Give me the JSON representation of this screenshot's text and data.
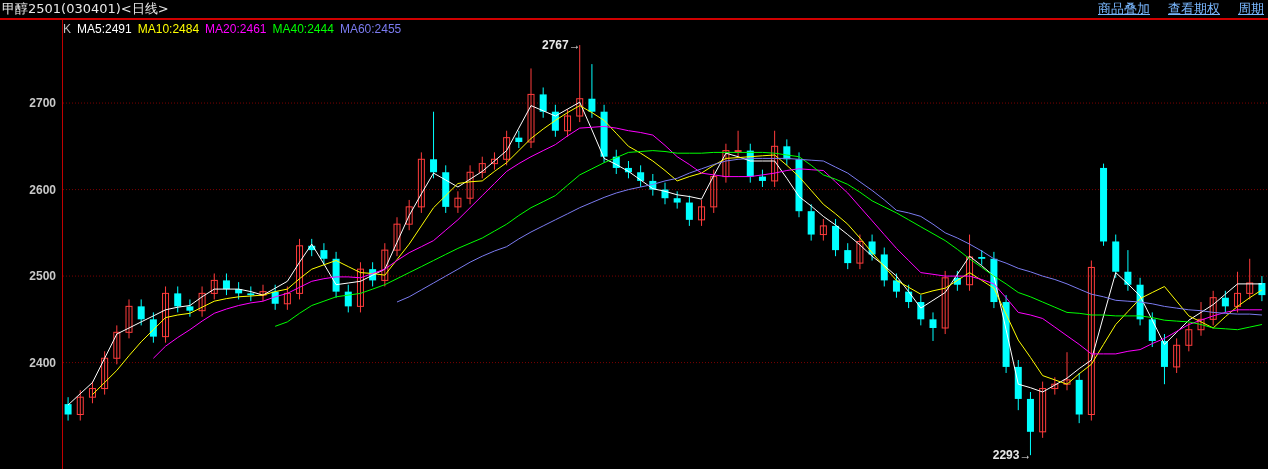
{
  "header": {
    "title": "甲醇2501(030401)<日线>",
    "links": [
      "商品叠加",
      "查看期权",
      "周期"
    ]
  },
  "chart": {
    "candles_label": {
      "text": "K",
      "color": "#c0c0c0"
    },
    "chart_data": {
      "type": "candlestick",
      "ylim": [
        2277,
        2796
      ],
      "yticks": [
        2400,
        2500,
        2600,
        2700
      ],
      "grid": true,
      "categories": [
        null,
        null,
        null,
        null,
        null,
        null,
        null,
        null,
        null,
        null,
        null,
        null,
        null,
        null,
        null,
        null,
        null,
        null,
        null,
        null,
        null,
        null,
        null,
        null,
        null,
        null,
        null,
        null,
        null,
        null,
        null,
        null,
        null,
        null,
        null,
        null,
        null,
        null,
        null,
        null,
        null,
        null,
        null,
        null,
        null,
        null,
        null,
        null,
        null,
        null,
        null,
        null,
        null,
        null,
        null,
        null,
        null,
        null,
        null,
        null,
        null,
        null,
        null,
        null,
        null,
        null,
        null,
        null,
        null,
        null,
        null,
        null,
        null,
        null,
        null,
        null,
        null,
        null,
        null,
        null,
        null,
        null,
        null,
        null,
        null,
        null,
        null,
        null,
        null,
        null,
        null,
        null,
        null,
        null,
        null,
        null,
        null,
        null,
        null
      ],
      "ohlc": [
        [
          2352,
          2360,
          2333,
          2340
        ],
        [
          2340,
          2368,
          2333,
          2360
        ],
        [
          2360,
          2378,
          2353,
          2370
        ],
        [
          2370,
          2413,
          2363,
          2405
        ],
        [
          2405,
          2443,
          2398,
          2435
        ],
        [
          2435,
          2473,
          2428,
          2465
        ],
        [
          2465,
          2473,
          2443,
          2450
        ],
        [
          2450,
          2458,
          2423,
          2430
        ],
        [
          2430,
          2488,
          2423,
          2480
        ],
        [
          2480,
          2488,
          2458,
          2465
        ],
        [
          2465,
          2473,
          2453,
          2460
        ],
        [
          2460,
          2488,
          2453,
          2480
        ],
        [
          2480,
          2503,
          2473,
          2495
        ],
        [
          2495,
          2503,
          2478,
          2485
        ],
        [
          2485,
          2493,
          2473,
          2480
        ],
        [
          2480,
          2488,
          2471,
          2478
        ],
        [
          2478,
          2490,
          2471,
          2482
        ],
        [
          2482,
          2490,
          2461,
          2468
        ],
        [
          2468,
          2488,
          2461,
          2480
        ],
        [
          2480,
          2543,
          2473,
          2535
        ],
        [
          2535,
          2543,
          2523,
          2530
        ],
        [
          2530,
          2538,
          2513,
          2520
        ],
        [
          2520,
          2528,
          2475,
          2482
        ],
        [
          2482,
          2490,
          2458,
          2465
        ],
        [
          2465,
          2516,
          2458,
          2508
        ],
        [
          2508,
          2516,
          2488,
          2495
        ],
        [
          2495,
          2538,
          2488,
          2530
        ],
        [
          2530,
          2568,
          2523,
          2560
        ],
        [
          2560,
          2588,
          2553,
          2580
        ],
        [
          2580,
          2643,
          2573,
          2635
        ],
        [
          2635,
          2690,
          2613,
          2620
        ],
        [
          2620,
          2628,
          2573,
          2580
        ],
        [
          2580,
          2598,
          2573,
          2590
        ],
        [
          2590,
          2628,
          2583,
          2620
        ],
        [
          2620,
          2638,
          2613,
          2630
        ],
        [
          2630,
          2643,
          2623,
          2635
        ],
        [
          2635,
          2668,
          2628,
          2660
        ],
        [
          2660,
          2668,
          2648,
          2655
        ],
        [
          2655,
          2740,
          2648,
          2710
        ],
        [
          2710,
          2718,
          2683,
          2690
        ],
        [
          2690,
          2698,
          2661,
          2668
        ],
        [
          2668,
          2693,
          2661,
          2685
        ],
        [
          2685,
          2767,
          2678,
          2705
        ],
        [
          2705,
          2745,
          2683,
          2690
        ],
        [
          2690,
          2698,
          2631,
          2638
        ],
        [
          2638,
          2646,
          2618,
          2625
        ],
        [
          2625,
          2633,
          2613,
          2620
        ],
        [
          2620,
          2628,
          2603,
          2610
        ],
        [
          2610,
          2618,
          2593,
          2600
        ],
        [
          2600,
          2608,
          2583,
          2590
        ],
        [
          2590,
          2598,
          2578,
          2585
        ],
        [
          2585,
          2593,
          2558,
          2565
        ],
        [
          2565,
          2588,
          2558,
          2580
        ],
        [
          2580,
          2623,
          2573,
          2615
        ],
        [
          2615,
          2653,
          2608,
          2645
        ],
        [
          2645,
          2668,
          2638,
          2645
        ],
        [
          2645,
          2653,
          2608,
          2615
        ],
        [
          2615,
          2623,
          2603,
          2610
        ],
        [
          2610,
          2668,
          2603,
          2650
        ],
        [
          2650,
          2658,
          2628,
          2635
        ],
        [
          2635,
          2643,
          2568,
          2575
        ],
        [
          2575,
          2583,
          2541,
          2548
        ],
        [
          2548,
          2566,
          2541,
          2558
        ],
        [
          2558,
          2566,
          2523,
          2530
        ],
        [
          2530,
          2538,
          2508,
          2515
        ],
        [
          2515,
          2548,
          2508,
          2540
        ],
        [
          2540,
          2548,
          2518,
          2525
        ],
        [
          2525,
          2533,
          2488,
          2495
        ],
        [
          2495,
          2503,
          2475,
          2482
        ],
        [
          2482,
          2490,
          2463,
          2470
        ],
        [
          2470,
          2478,
          2443,
          2450
        ],
        [
          2450,
          2458,
          2425,
          2440
        ],
        [
          2440,
          2506,
          2433,
          2498
        ],
        [
          2498,
          2506,
          2483,
          2490
        ],
        [
          2490,
          2548,
          2483,
          2522
        ],
        [
          2522,
          2530,
          2513,
          2520
        ],
        [
          2520,
          2528,
          2463,
          2470
        ],
        [
          2470,
          2478,
          2388,
          2395
        ],
        [
          2395,
          2403,
          2345,
          2358
        ],
        [
          2358,
          2366,
          2293,
          2320
        ],
        [
          2320,
          2378,
          2313,
          2370
        ],
        [
          2370,
          2383,
          2363,
          2375
        ],
        [
          2375,
          2412,
          2368,
          2380
        ],
        [
          2380,
          2388,
          2330,
          2340
        ],
        [
          2340,
          2518,
          2333,
          2510
        ],
        [
          2625,
          2630,
          2535,
          2540
        ],
        [
          2540,
          2548,
          2498,
          2505
        ],
        [
          2505,
          2530,
          2483,
          2490
        ],
        [
          2490,
          2498,
          2443,
          2450
        ],
        [
          2450,
          2458,
          2418,
          2425
        ],
        [
          2425,
          2433,
          2375,
          2395
        ],
        [
          2395,
          2428,
          2388,
          2420
        ],
        [
          2420,
          2446,
          2413,
          2438
        ],
        [
          2438,
          2470,
          2431,
          2450
        ],
        [
          2450,
          2483,
          2443,
          2475
        ],
        [
          2475,
          2483,
          2458,
          2465
        ],
        [
          2465,
          2505,
          2458,
          2480
        ],
        [
          2480,
          2520,
          2473,
          2492
        ],
        [
          2492,
          2500,
          2471,
          2478
        ]
      ],
      "series": [
        {
          "name": "MA5:2491",
          "type": "line",
          "color": "#ffffff",
          "values": [
            2351,
            2364,
            2377,
            2405,
            2433,
            2440,
            2447,
            2454,
            2461,
            2464,
            2466,
            2476,
            2485,
            2485,
            2485,
            2482,
            2478,
            2486,
            2494,
            2516,
            2537,
            2514,
            2490,
            2492,
            2494,
            2501,
            2508,
            2539,
            2570,
            2595,
            2619,
            2611,
            2603,
            2612,
            2621,
            2633,
            2645,
            2671,
            2697,
            2691,
            2685,
            2693,
            2701,
            2669,
            2636,
            2629,
            2621,
            2611,
            2601,
            2598,
            2594,
            2592,
            2589,
            2616,
            2642,
            2638,
            2633,
            2633,
            2633,
            2613,
            2592,
            2581,
            2569,
            2559,
            2548,
            2536,
            2523,
            2512,
            2500,
            2482,
            2463,
            2472,
            2481,
            2502,
            2523,
            2512,
            2500,
            2438,
            2375,
            2371,
            2366,
            2374,
            2382,
            2393,
            2403,
            2454,
            2504,
            2491,
            2477,
            2449,
            2421,
            2435,
            2449,
            2458,
            2467,
            2479,
            2491,
            2491,
            2491
          ]
        },
        {
          "name": "MA10:2484",
          "type": "line",
          "color": "#ffff00",
          "values": [
            null,
            null,
            2363,
            2377,
            2391,
            2408,
            2424,
            2438,
            2452,
            2455,
            2457,
            2464,
            2471,
            2474,
            2476,
            2477,
            2478,
            2482,
            2485,
            2497,
            2508,
            2513,
            2518,
            2511,
            2504,
            2503,
            2501,
            2519,
            2537,
            2558,
            2579,
            2593,
            2607,
            2609,
            2610,
            2621,
            2631,
            2645,
            2659,
            2670,
            2680,
            2689,
            2697,
            2689,
            2680,
            2665,
            2650,
            2642,
            2633,
            2622,
            2610,
            2615,
            2619,
            2628,
            2636,
            2637,
            2638,
            2639,
            2640,
            2628,
            2615,
            2599,
            2583,
            2572,
            2560,
            2544,
            2527,
            2511,
            2495,
            2487,
            2479,
            2483,
            2486,
            2495,
            2504,
            2495,
            2486,
            2456,
            2426,
            2406,
            2385,
            2380,
            2375,
            2387,
            2398,
            2421,
            2444,
            2459,
            2474,
            2481,
            2488,
            2471,
            2454,
            2447,
            2440,
            2453,
            2465,
            2475,
            2484
          ]
        },
        {
          "name": "MA20:2461",
          "type": "line",
          "color": "#ff00ff",
          "values": [
            null,
            null,
            null,
            null,
            null,
            null,
            null,
            2405,
            2419,
            2429,
            2438,
            2448,
            2457,
            2462,
            2466,
            2469,
            2471,
            2476,
            2480,
            2487,
            2494,
            2497,
            2499,
            2499,
            2498,
            2503,
            2508,
            2518,
            2527,
            2534,
            2541,
            2553,
            2565,
            2579,
            2593,
            2607,
            2621,
            2630,
            2638,
            2645,
            2652,
            2662,
            2671,
            2672,
            2673,
            2671,
            2668,
            2666,
            2663,
            2651,
            2638,
            2629,
            2619,
            2617,
            2615,
            2615,
            2615,
            2617,
            2619,
            2622,
            2624,
            2623,
            2622,
            2609,
            2596,
            2580,
            2564,
            2548,
            2532,
            2518,
            2504,
            2502,
            2500,
            2500,
            2500,
            2496,
            2491,
            2475,
            2458,
            2455,
            2451,
            2441,
            2431,
            2421,
            2410,
            2410,
            2410,
            2413,
            2415,
            2422,
            2428,
            2436,
            2444,
            2449,
            2454,
            2458,
            2461,
            2461,
            2461
          ]
        },
        {
          "name": "MA40:2444",
          "type": "line",
          "color": "#00ff00",
          "values": [
            null,
            null,
            null,
            null,
            null,
            null,
            null,
            null,
            null,
            null,
            null,
            null,
            null,
            null,
            null,
            null,
            null,
            2442,
            2447,
            2457,
            2466,
            2471,
            2476,
            2478,
            2480,
            2485,
            2490,
            2497,
            2504,
            2511,
            2518,
            2525,
            2532,
            2538,
            2544,
            2552,
            2560,
            2570,
            2579,
            2586,
            2593,
            2605,
            2617,
            2624,
            2631,
            2637,
            2643,
            2644,
            2645,
            2644,
            2642,
            2642,
            2642,
            2643,
            2643,
            2643,
            2643,
            2643,
            2642,
            2640,
            2638,
            2628,
            2617,
            2612,
            2606,
            2597,
            2587,
            2580,
            2573,
            2565,
            2557,
            2549,
            2541,
            2531,
            2520,
            2510,
            2500,
            2491,
            2481,
            2476,
            2470,
            2464,
            2458,
            2457,
            2455,
            2455,
            2454,
            2454,
            2454,
            2452,
            2449,
            2448,
            2447,
            2444,
            2440,
            2439,
            2438,
            2441,
            2444
          ]
        },
        {
          "name": "MA60:2455",
          "type": "line",
          "color": "#7b7bf0",
          "values": [
            null,
            null,
            null,
            null,
            null,
            null,
            null,
            null,
            null,
            null,
            null,
            null,
            null,
            null,
            null,
            null,
            null,
            null,
            null,
            null,
            null,
            null,
            null,
            null,
            null,
            null,
            null,
            2470,
            2476,
            2484,
            2492,
            2500,
            2508,
            2516,
            2523,
            2529,
            2534,
            2543,
            2551,
            2558,
            2565,
            2572,
            2579,
            2585,
            2591,
            2596,
            2600,
            2603,
            2606,
            2610,
            2613,
            2619,
            2624,
            2629,
            2633,
            2635,
            2636,
            2636,
            2636,
            2636,
            2635,
            2634,
            2633,
            2626,
            2619,
            2609,
            2599,
            2588,
            2576,
            2573,
            2569,
            2560,
            2550,
            2544,
            2537,
            2529,
            2520,
            2515,
            2509,
            2505,
            2500,
            2496,
            2491,
            2485,
            2479,
            2476,
            2472,
            2471,
            2470,
            2468,
            2465,
            2463,
            2461,
            2460,
            2458,
            2457,
            2456,
            2456,
            2455
          ]
        }
      ],
      "annotations": [
        "2767→",
        "2293→"
      ]
    }
  }
}
